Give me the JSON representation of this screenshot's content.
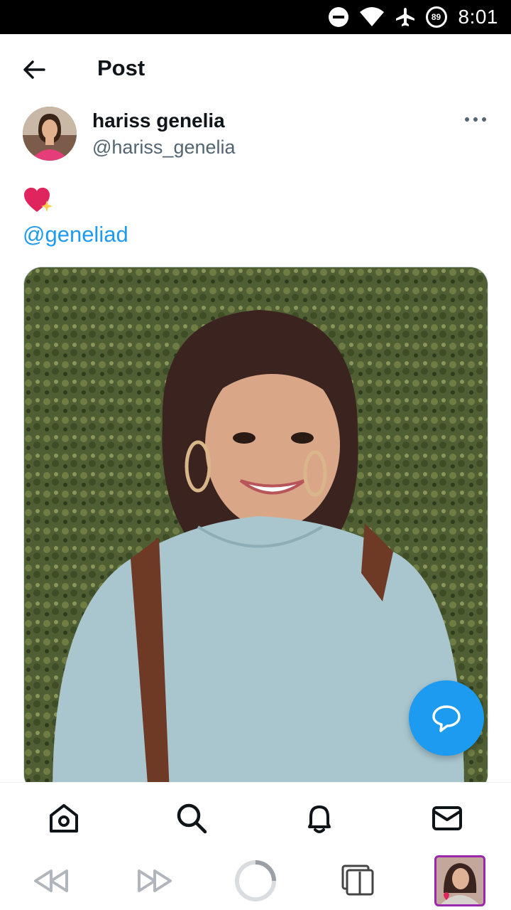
{
  "status_bar": {
    "time": "8:01",
    "battery_level": "89",
    "icons": [
      "do-not-disturb-icon",
      "wifi-icon",
      "airplane-mode-icon",
      "battery-icon"
    ]
  },
  "header": {
    "title": "Post",
    "back_icon": "back-arrow-icon"
  },
  "post": {
    "author": {
      "display_name": "hariss genelia",
      "handle": "@hariss_genelia"
    },
    "more_icon": "more-icon",
    "emoji": "sparkling-heart-emoji",
    "mention": "@geneliad",
    "media": "photo"
  },
  "fab_icon": "reply-bubble-icon",
  "bottom_nav": {
    "items": [
      "home-icon",
      "search-icon",
      "notifications-icon",
      "messages-icon"
    ]
  },
  "browser_bar": {
    "items": [
      "rewind-icon",
      "fast-forward-icon",
      "loading-icon",
      "tabs-icon",
      "tab-thumbnail"
    ]
  },
  "colors": {
    "accent": "#1d9bf0",
    "text_primary": "#0f1419",
    "text_secondary": "#536471",
    "thumbnail_border": "#9b27af"
  }
}
